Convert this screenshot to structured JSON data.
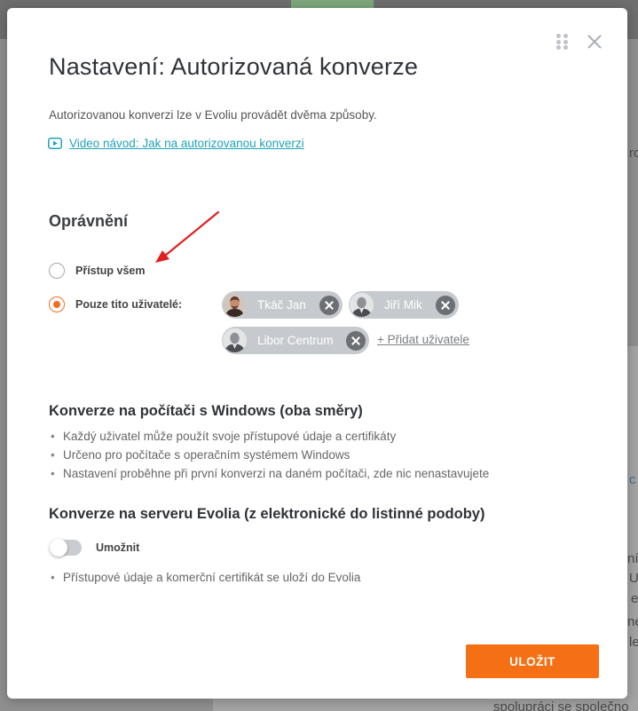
{
  "background": {
    "fragments": [
      "ro",
      "c",
      "ní",
      "U",
      "e",
      "ne",
      "le",
      "spolupráci se společno"
    ]
  },
  "modal": {
    "title": "Nastavení: Autorizovaná konverze",
    "description": "Autorizovanou konverzi lze v Evoliu provádět dvěma způsoby.",
    "video_link": "Video návod: Jak na autorizovanou konverzi",
    "permissions": {
      "heading": "Oprávnění",
      "options": [
        {
          "label": "Přístup všem",
          "selected": false
        },
        {
          "label": "Pouze tito uživatelé:",
          "selected": true
        }
      ],
      "users": [
        {
          "name": "Tkáč Jan",
          "avatar": "photo-avatar"
        },
        {
          "name": "Jiří Mik",
          "avatar": "default-user-avatar"
        },
        {
          "name": "Libor Centrum",
          "avatar": "default-user-avatar"
        }
      ],
      "add_user_label": "+ Přidat uživatele"
    },
    "windows_section": {
      "heading": "Konverze na počítači s Windows (oba směry)",
      "bullets": [
        "Každý uživatel může použít svoje přístupové údaje a certifikáty",
        "Určeno pro počítače s operačním systémem Windows",
        "Nastavení proběhne při první konverzi na daném počítači, zde nic nenastavujete"
      ]
    },
    "server_section": {
      "heading": "Konverze na serveru Evolia (z elektronické do listinné podoby)",
      "toggle_label": "Umožnit",
      "toggle_on": false,
      "bullets": [
        "Přístupové údaje a komerční certifikát se uloží do Evolia"
      ]
    },
    "save_label": "ULOŽIT"
  },
  "colors": {
    "accent": "#f57014",
    "link": "#1fa3b9",
    "annotation_arrow": "#e02020"
  }
}
